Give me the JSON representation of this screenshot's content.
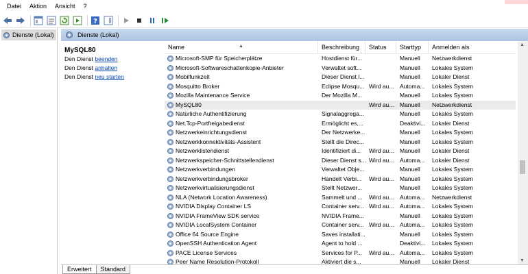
{
  "menu": [
    "Datei",
    "Aktion",
    "Ansicht",
    "?"
  ],
  "toolbar": {
    "icons": [
      "back-arrow-icon",
      "forward-arrow-icon",
      "console-tree-icon",
      "properties-icon",
      "refresh-icon",
      "export-list-icon",
      "help-icon",
      "show-hide-icon",
      "play-icon",
      "stop-icon",
      "pause-icon",
      "restart-icon"
    ]
  },
  "tree": {
    "root_label": "Dienste (Lokal)"
  },
  "pane_header": {
    "title": "Dienste (Lokal)"
  },
  "description": {
    "service_name": "MySQL80",
    "line1_prefix": "Den Dienst ",
    "line1_link": "beenden",
    "line2_prefix": "Den Dienst ",
    "line2_link": "anhalten",
    "line3_prefix": "Den Dienst ",
    "line3_link": "neu starten"
  },
  "table": {
    "columns": [
      "Name",
      "Beschreibung",
      "Status",
      "Starttyp",
      "Anmelden als"
    ],
    "rows": [
      {
        "name": "Microsoft-SMP für Speicherplätze",
        "desc": "Hostdienst für...",
        "status": "",
        "start": "Manuell",
        "login": "Netzwerkdienst"
      },
      {
        "name": "Microsoft-Softwareschattenkopie-Anbieter",
        "desc": "Verwaltet soft...",
        "status": "",
        "start": "Manuell",
        "login": "Lokales System"
      },
      {
        "name": "Mobilfunkzeit",
        "desc": "Dieser Dienst l...",
        "status": "",
        "start": "Manuell",
        "login": "Lokaler Dienst"
      },
      {
        "name": "Mosquitto Broker",
        "desc": "Eclipse Mosqu...",
        "status": "Wird au...",
        "start": "Automa...",
        "login": "Lokales System"
      },
      {
        "name": "Mozilla Maintenance Service",
        "desc": "Der Mozilla M...",
        "status": "",
        "start": "Manuell",
        "login": "Lokales System"
      },
      {
        "name": "MySQL80",
        "desc": "",
        "status": "Wird au...",
        "start": "Manuell",
        "login": "Netzwerkdienst"
      },
      {
        "name": "Natürliche Authentifizierung",
        "desc": "Signalaggrega...",
        "status": "",
        "start": "Manuell",
        "login": "Lokales System"
      },
      {
        "name": "Net.Tcp-Portfreigabedienst",
        "desc": "Ermöglicht es,...",
        "status": "",
        "start": "Deaktivi...",
        "login": "Lokaler Dienst"
      },
      {
        "name": "Netzwerkeinrichtungsdienst",
        "desc": "Der Netzwerke...",
        "status": "",
        "start": "Manuell",
        "login": "Lokales System"
      },
      {
        "name": "Netzwerkkonnektivitäts-Assistent",
        "desc": "Stellt die Direc...",
        "status": "",
        "start": "Manuell",
        "login": "Lokales System"
      },
      {
        "name": "Netzwerklistendienst",
        "desc": "Identifiziert di...",
        "status": "Wird au...",
        "start": "Manuell",
        "login": "Lokaler Dienst"
      },
      {
        "name": "Netzwerkspeicher-Schnittstellendienst",
        "desc": "Dieser Dienst s...",
        "status": "Wird au...",
        "start": "Automa...",
        "login": "Lokaler Dienst"
      },
      {
        "name": "Netzwerkverbindungen",
        "desc": "Verwaltet Obje...",
        "status": "",
        "start": "Manuell",
        "login": "Lokales System"
      },
      {
        "name": "Netzwerkverbindungsbroker",
        "desc": "Handelt Verbi...",
        "status": "Wird au...",
        "start": "Manuell",
        "login": "Lokales System"
      },
      {
        "name": "Netzwerkvirtualisierungsdienst",
        "desc": "Stellt Netzwer...",
        "status": "",
        "start": "Manuell",
        "login": "Lokales System"
      },
      {
        "name": "NLA (Network Location Awareness)",
        "desc": "Sammelt und ...",
        "status": "Wird au...",
        "start": "Automa...",
        "login": "Netzwerkdienst"
      },
      {
        "name": "NVIDIA Display Container LS",
        "desc": "Container serv...",
        "status": "Wird au...",
        "start": "Automa...",
        "login": "Lokales System"
      },
      {
        "name": "NVIDIA FrameView SDK service",
        "desc": "NVIDIA Frame...",
        "status": "",
        "start": "Manuell",
        "login": "Lokales System"
      },
      {
        "name": "NVIDIA LocalSystem Container",
        "desc": "Container serv...",
        "status": "Wird au...",
        "start": "Automa...",
        "login": "Lokales System"
      },
      {
        "name": "Office 64 Source Engine",
        "desc": "Saves installati...",
        "status": "",
        "start": "Manuell",
        "login": "Lokales System"
      },
      {
        "name": "OpenSSH Authentication Agent",
        "desc": "Agent to hold ...",
        "status": "",
        "start": "Deaktivi...",
        "login": "Lokales System"
      },
      {
        "name": "PACE License Services",
        "desc": "Services for P...",
        "status": "Wird au...",
        "start": "Automa...",
        "login": "Lokales System"
      },
      {
        "name": "Peer Name Resolution-Protokoll",
        "desc": "Aktiviert die s...",
        "status": "",
        "start": "Manuell",
        "login": "Lokaler Dienst"
      }
    ],
    "selected_index": 5
  },
  "tabs": [
    "Erweitert",
    "Standard"
  ],
  "active_tab": 0,
  "colors": {
    "header_gradient_top": "#c9d9ee",
    "header_gradient_bottom": "#aec5e3",
    "link": "#0645ad",
    "selected_row": "#ebebeb"
  }
}
